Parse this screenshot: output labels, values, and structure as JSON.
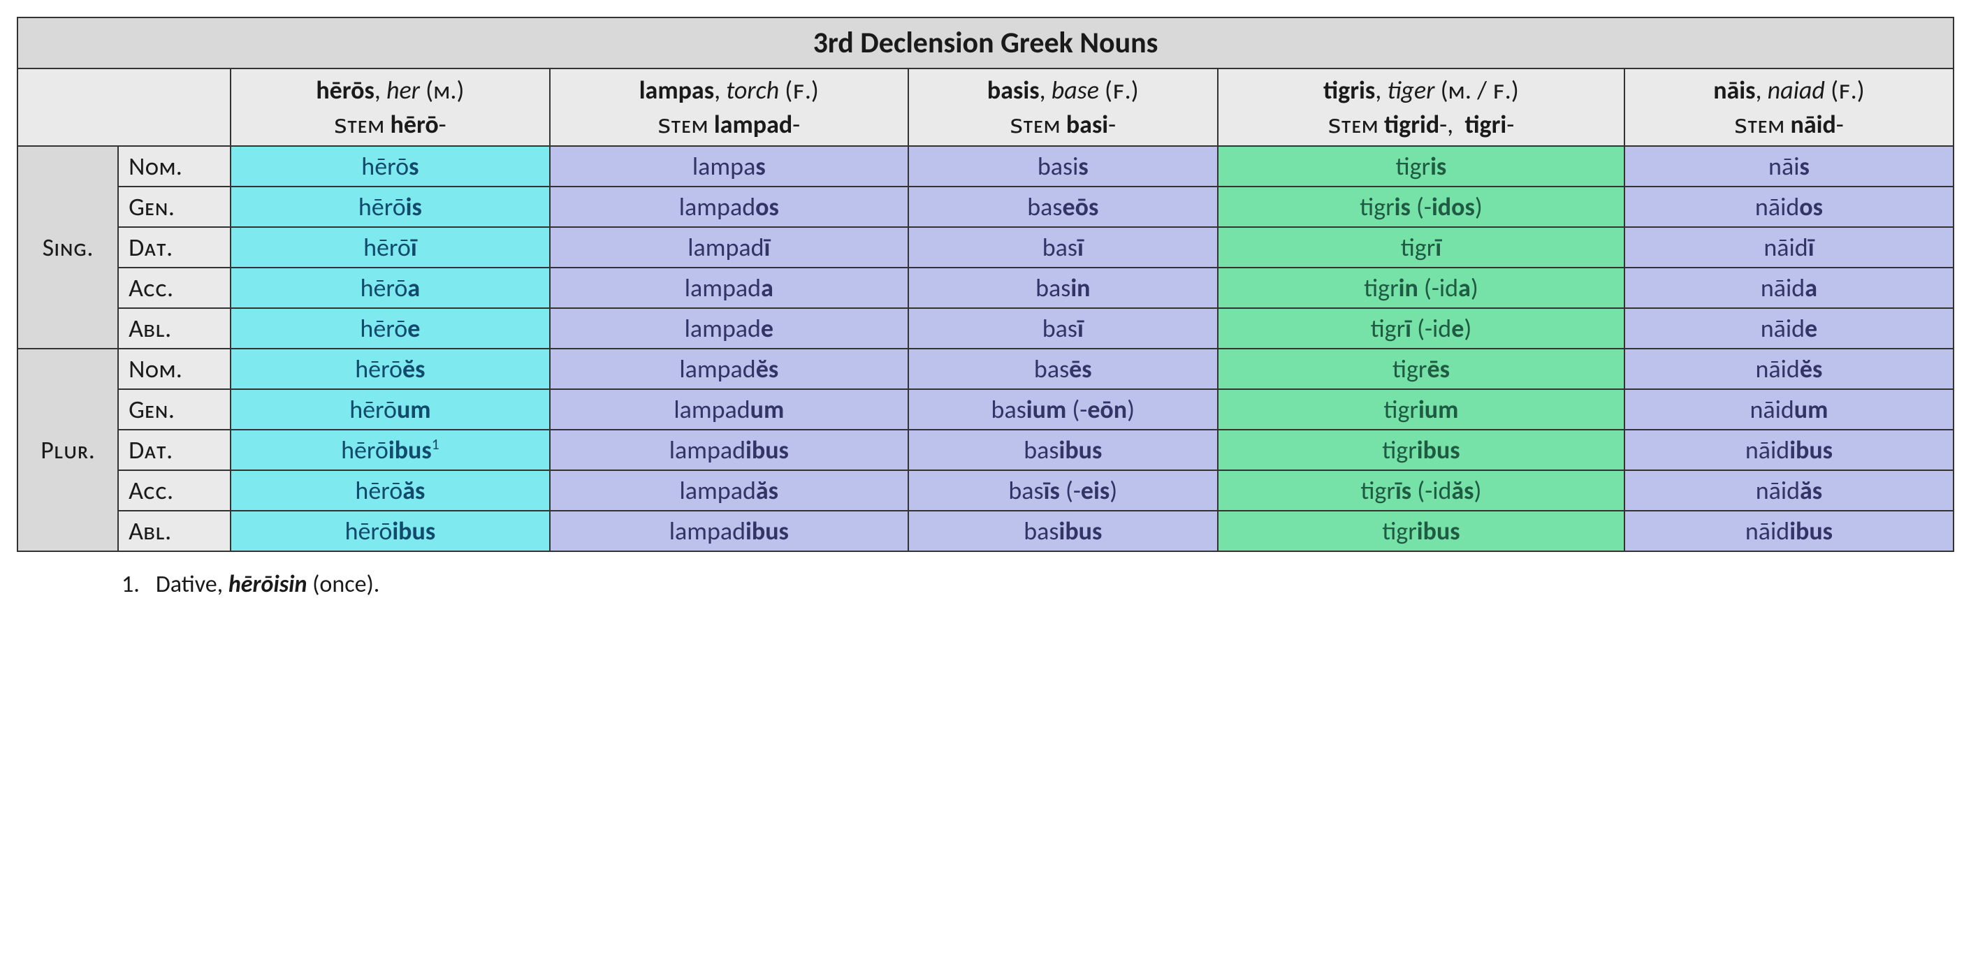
{
  "title": "3rd Declension Greek Nouns",
  "columns": [
    {
      "word": "hērōs",
      "gloss": "her",
      "gender": "(ᴍ.)",
      "stem_label": "ꜱᴛᴇᴍ",
      "stem": "hērō",
      "color": "cyan"
    },
    {
      "word": "lampas",
      "gloss": "torch",
      "gender": "(ꜰ.)",
      "stem_label": "ꜱᴛᴇᴍ",
      "stem": "lampad",
      "color": "lav"
    },
    {
      "word": "basis",
      "gloss": "base",
      "gender": "(ꜰ.)",
      "stem_label": "ꜱᴛᴇᴍ",
      "stem": "basi",
      "color": "lav"
    },
    {
      "word": "tigris",
      "gloss": "tiger",
      "gender": "(ᴍ. / ꜰ.)",
      "stem_label": "ꜱᴛᴇᴍ",
      "stem": "tigrid",
      "stem2": "tigri",
      "color": "green"
    },
    {
      "word": "nāis",
      "gloss": "naiad",
      "gender": "(ꜰ.)",
      "stem_label": "ꜱᴛᴇᴍ",
      "stem": "nāid",
      "color": "lav"
    }
  ],
  "number_labels": {
    "sing": "Sɪɴɢ.",
    "plur": "Pʟᴜʀ."
  },
  "case_labels": {
    "nom": "Nᴏᴍ.",
    "gen": "Gᴇɴ.",
    "dat": "Dᴀᴛ.",
    "acc": "Aᴄᴄ.",
    "abl": "Aʙʟ."
  },
  "forms": {
    "sing": {
      "nom": [
        {
          "pre": "hērō",
          "end": "s"
        },
        {
          "pre": "lampa",
          "end": "s"
        },
        {
          "pre": "basi",
          "end": "s"
        },
        {
          "pre": "tigr",
          "end": "is"
        },
        {
          "pre": "nāi",
          "end": "s"
        }
      ],
      "gen": [
        {
          "pre": "hērō",
          "end": "is"
        },
        {
          "pre": "lampad",
          "end": "os"
        },
        {
          "pre": "bas",
          "end": "eōs"
        },
        {
          "pre": "tigr",
          "end": "is",
          "alt_pre": " (-",
          "alt_end": "idos",
          "alt_post": ")"
        },
        {
          "pre": "nāid",
          "end": "os"
        }
      ],
      "dat": [
        {
          "pre": "hērō",
          "end": "ī"
        },
        {
          "pre": "lampad",
          "end": "ī"
        },
        {
          "pre": "bas",
          "end": "ī"
        },
        {
          "pre": "tigr",
          "end": "ī"
        },
        {
          "pre": "nāid",
          "end": "ī"
        }
      ],
      "acc": [
        {
          "pre": "hērō",
          "end": "a"
        },
        {
          "pre": "lampad",
          "end": "a"
        },
        {
          "pre": "bas",
          "end": "in"
        },
        {
          "pre": "tigr",
          "end": "in",
          "alt_pre": " (-id",
          "alt_end": "a",
          "alt_post": ")"
        },
        {
          "pre": "nāid",
          "end": "a"
        }
      ],
      "abl": [
        {
          "pre": "hērō",
          "end": "e"
        },
        {
          "pre": "lampad",
          "end": "e"
        },
        {
          "pre": "bas",
          "end": "ī"
        },
        {
          "pre": "tigr",
          "end": "ī",
          "alt_pre": " (-id",
          "alt_end": "e",
          "alt_post": ")"
        },
        {
          "pre": "nāid",
          "end": "e"
        }
      ]
    },
    "plur": {
      "nom": [
        {
          "pre": "hērō",
          "end": "ĕs"
        },
        {
          "pre": "lampad",
          "end": "ĕs"
        },
        {
          "pre": "bas",
          "end": "ēs"
        },
        {
          "pre": "tigr",
          "end": "ēs"
        },
        {
          "pre": "nāid",
          "end": "ĕs"
        }
      ],
      "gen": [
        {
          "pre": "hērō",
          "end": "um"
        },
        {
          "pre": "lampad",
          "end": "um"
        },
        {
          "pre": "bas",
          "end": "ium",
          "alt_pre": " (-",
          "alt_end": "eōn",
          "alt_post": ")"
        },
        {
          "pre": "tigr",
          "end": "ium"
        },
        {
          "pre": "nāid",
          "end": "um"
        }
      ],
      "dat": [
        {
          "pre": "hērō",
          "end": "ibus",
          "sup": "1"
        },
        {
          "pre": "lampad",
          "end": "ibus"
        },
        {
          "pre": "bas",
          "end": "ibus"
        },
        {
          "pre": "tigr",
          "end": "ibus"
        },
        {
          "pre": "nāid",
          "end": "ibus"
        }
      ],
      "acc": [
        {
          "pre": "hērō",
          "end": "ăs"
        },
        {
          "pre": "lampad",
          "end": "ăs"
        },
        {
          "pre": "bas",
          "end": "īs",
          "alt_pre": " (-",
          "alt_end": "eis",
          "alt_post": ")"
        },
        {
          "pre": "tigr",
          "end": "īs",
          "alt_pre": " (-id",
          "alt_end": "ăs",
          "alt_post": ")"
        },
        {
          "pre": "nāid",
          "end": "ăs"
        }
      ],
      "abl": [
        {
          "pre": "hērō",
          "end": "ibus"
        },
        {
          "pre": "lampad",
          "end": "ibus"
        },
        {
          "pre": "bas",
          "end": "ibus"
        },
        {
          "pre": "tigr",
          "end": "ibus"
        },
        {
          "pre": "nāid",
          "end": "ibus"
        }
      ]
    }
  },
  "footnote": {
    "num": "1.",
    "label": "Dative,",
    "form": "hērōisin",
    "post": "(once)."
  }
}
